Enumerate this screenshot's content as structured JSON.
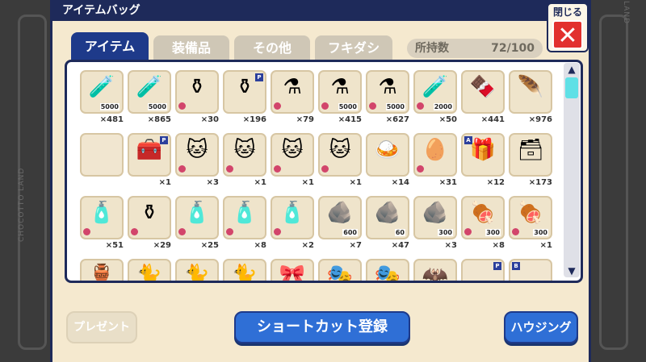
{
  "window": {
    "title": "アイテムバッグ",
    "close_label": "閉じる",
    "close_glyph": "✕"
  },
  "background": {
    "side_text_left": "CHOCOTTO LAND",
    "side_text_right": "CHOCOTTO LAND"
  },
  "tabs": [
    {
      "label": "アイテム",
      "active": true
    },
    {
      "label": "装備品",
      "active": false
    },
    {
      "label": "その他",
      "active": false
    },
    {
      "label": "フキダシ",
      "active": false
    }
  ],
  "inventory_count": {
    "label": "所持数",
    "value": "72/100"
  },
  "grid": {
    "rows": [
      [
        {
          "icon": "potion-blue-icon",
          "glyph": "🧪",
          "sub": "5000",
          "qty": "×481"
        },
        {
          "icon": "potion-teal-icon",
          "glyph": "🧪",
          "sub": "5000",
          "qty": "×865"
        },
        {
          "icon": "potion-orange-icon",
          "glyph": "⚱",
          "minus": true,
          "qty": "×30"
        },
        {
          "icon": "potion-orange-icon",
          "glyph": "⚱",
          "tag": "P",
          "qty": "×196"
        },
        {
          "icon": "flask-orange-icon",
          "glyph": "⚗",
          "minus": true,
          "qty": "×79"
        },
        {
          "icon": "flask-orange-icon",
          "glyph": "⚗",
          "minus": true,
          "sub": "5000",
          "qty": "×415"
        },
        {
          "icon": "flask-green-icon",
          "glyph": "⚗",
          "minus": true,
          "sub": "5000",
          "qty": "×627"
        },
        {
          "icon": "potion-blue-icon",
          "glyph": "🧪",
          "minus": true,
          "sub": "2000",
          "qty": "×50"
        },
        {
          "icon": "heart-chocolate-icon",
          "glyph": "🍫",
          "qty": "×441"
        },
        {
          "icon": "feather-icon",
          "glyph": "🪶",
          "qty": "×976"
        }
      ],
      [
        {
          "icon": "empty-slot-icon",
          "glyph": "",
          "qty": ""
        },
        {
          "icon": "treasure-box-icon",
          "glyph": "🧰",
          "tag": "P",
          "qty": "×1"
        },
        {
          "icon": "cat-face-icon",
          "glyph": "🐱",
          "minus": true,
          "qty": "×3"
        },
        {
          "icon": "cat-face-icon",
          "glyph": "🐱",
          "minus": true,
          "qty": "×1"
        },
        {
          "icon": "cat-face-icon",
          "glyph": "🐱",
          "minus": true,
          "qty": "×1"
        },
        {
          "icon": "cat-face-icon",
          "glyph": "🐱",
          "minus": true,
          "qty": "×1"
        },
        {
          "icon": "curry-icon",
          "glyph": "🍛",
          "qty": "×14"
        },
        {
          "icon": "egg-icon",
          "glyph": "🥚",
          "minus": true,
          "qty": "×31"
        },
        {
          "icon": "gift-box-icon",
          "glyph": "🎁",
          "tag": "A",
          "tag_left": true,
          "qty": "×12"
        },
        {
          "icon": "chest-icon",
          "glyph": "🗃",
          "qty": "×173"
        }
      ],
      [
        {
          "icon": "up-bottle-icon",
          "glyph": "🧴",
          "minus": true,
          "qty": "×51"
        },
        {
          "icon": "potion-red-icon",
          "glyph": "⚱",
          "minus": true,
          "qty": "×29"
        },
        {
          "icon": "up-bottle-icon",
          "glyph": "🧴",
          "minus": true,
          "qty": "×25"
        },
        {
          "icon": "up-bottle-icon",
          "glyph": "🧴",
          "minus": true,
          "qty": "×8"
        },
        {
          "icon": "up-bottle-icon",
          "glyph": "🧴",
          "minus": true,
          "qty": "×2"
        },
        {
          "icon": "ore-bag-icon",
          "glyph": "🪨",
          "sub": "600",
          "qty": "×7"
        },
        {
          "icon": "ore-bag-icon",
          "glyph": "🪨",
          "sub": "60",
          "qty": "×47"
        },
        {
          "icon": "ore-bag-icon",
          "glyph": "🪨",
          "sub": "300",
          "qty": "×3"
        },
        {
          "icon": "food-plate-icon",
          "glyph": "🍖",
          "minus": true,
          "sub": "300",
          "qty": "×8"
        },
        {
          "icon": "food-plate-icon",
          "glyph": "🍖",
          "minus": true,
          "sub": "300",
          "qty": "×1"
        }
      ],
      [
        {
          "icon": "jar-icon",
          "glyph": "🏺",
          "qty": ""
        },
        {
          "icon": "cat-black-icon",
          "glyph": "🐈",
          "qty": ""
        },
        {
          "icon": "cat-white-icon",
          "glyph": "🐈",
          "qty": ""
        },
        {
          "icon": "cat-black-icon",
          "glyph": "🐈",
          "qty": ""
        },
        {
          "icon": "item-icon",
          "glyph": "🎀",
          "qty": ""
        },
        {
          "icon": "item-icon",
          "glyph": "🎭",
          "qty": ""
        },
        {
          "icon": "item-icon",
          "glyph": "🎭",
          "qty": ""
        },
        {
          "icon": "item-icon",
          "glyph": "🦇",
          "qty": ""
        },
        {
          "icon": "item-icon",
          "glyph": "",
          "tag": "P",
          "qty": ""
        },
        {
          "icon": "item-icon",
          "glyph": "",
          "tag": "B",
          "tag_left": true,
          "qty": ""
        }
      ]
    ]
  },
  "buttons": {
    "present": "プレゼント",
    "shortcut": "ショートカット登録",
    "housing": "ハウジング"
  }
}
